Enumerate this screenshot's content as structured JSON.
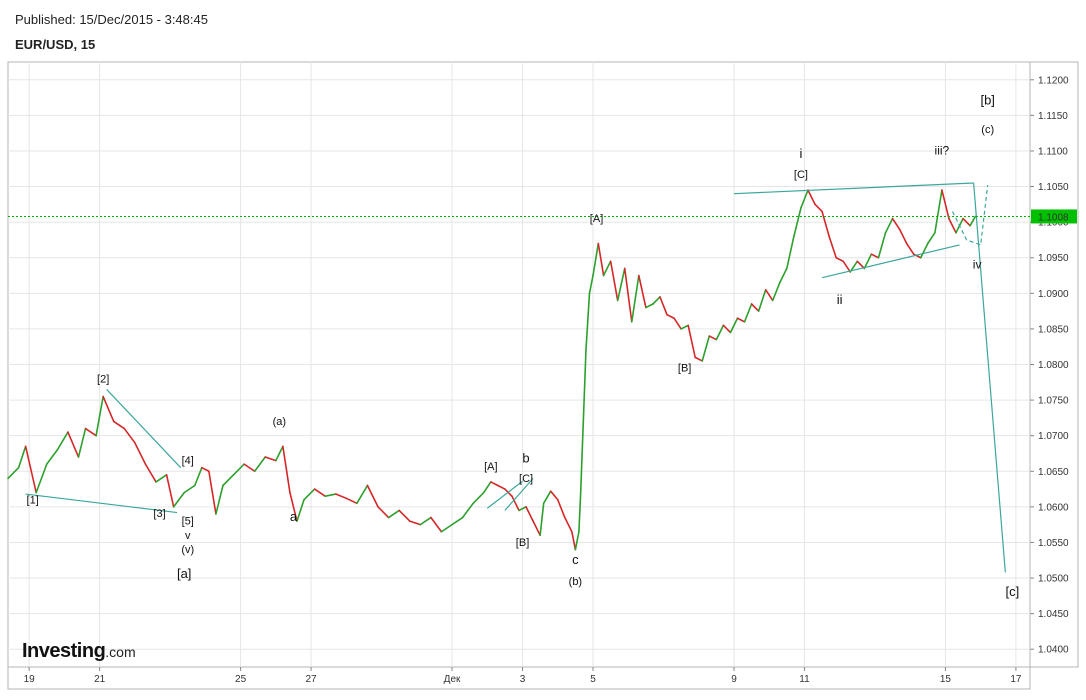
{
  "header": {
    "published": "Published: 15/Dec/2015 - 3:48:45",
    "symbol": "EUR/USD, 15"
  },
  "logo": {
    "brand": "Investing",
    "domain": ".com"
  },
  "colors": {
    "up": "#2ca02c",
    "down": "#d62728",
    "pattern": "#3aa79a",
    "current_price_line": "#00b000",
    "current_price_badge": "#00c000",
    "grid": "#e6e6e6"
  },
  "chart_data": {
    "type": "line",
    "ylim": [
      1.0375,
      1.1225
    ],
    "yticks": [
      1.04,
      1.045,
      1.05,
      1.055,
      1.06,
      1.065,
      1.07,
      1.075,
      1.08,
      1.085,
      1.09,
      1.095,
      1.1,
      1.105,
      1.11,
      1.115,
      1.12
    ],
    "ytick_labels": [
      "1.0400",
      "1.0450",
      "1.0500",
      "1.0550",
      "1.0600",
      "1.0650",
      "1.0700",
      "1.0750",
      "1.0800",
      "1.0850",
      "1.0900",
      "1.0950",
      "1.1000",
      "1.1050",
      "1.1100",
      "1.1150",
      "1.1200"
    ],
    "xlim": [
      18.4,
      17.4
    ],
    "x_axis_note": "day index: 18..30 = Nov 18..30, 31..47 = Dec 1..17",
    "xlim_index": [
      18.4,
      47.4
    ],
    "xticks": [
      {
        "t": 19,
        "label": "19"
      },
      {
        "t": 21,
        "label": "21"
      },
      {
        "t": 25,
        "label": "25"
      },
      {
        "t": 27,
        "label": "27"
      },
      {
        "t": 31,
        "label": "Дек"
      },
      {
        "t": 33,
        "label": "3"
      },
      {
        "t": 35,
        "label": "5"
      },
      {
        "t": 39,
        "label": "9"
      },
      {
        "t": 41,
        "label": "11"
      },
      {
        "t": 45,
        "label": "15"
      },
      {
        "t": 47,
        "label": "17"
      }
    ],
    "current_price": {
      "value": 1.1008,
      "label": "1.1008"
    },
    "price_path": [
      [
        18.4,
        1.064
      ],
      [
        18.7,
        1.0655
      ],
      [
        18.9,
        1.0685
      ],
      [
        19.2,
        1.062
      ],
      [
        19.5,
        1.066
      ],
      [
        19.8,
        1.068
      ],
      [
        20.1,
        1.0705
      ],
      [
        20.4,
        1.067
      ],
      [
        20.6,
        1.071
      ],
      [
        20.9,
        1.07
      ],
      [
        21.1,
        1.0755
      ],
      [
        21.4,
        1.072
      ],
      [
        21.7,
        1.071
      ],
      [
        22.0,
        1.069
      ],
      [
        22.3,
        1.066
      ],
      [
        22.6,
        1.0635
      ],
      [
        22.9,
        1.0645
      ],
      [
        23.1,
        1.06
      ],
      [
        23.4,
        1.062
      ],
      [
        23.7,
        1.063
      ],
      [
        23.9,
        1.0655
      ],
      [
        24.1,
        1.065
      ],
      [
        24.3,
        1.059
      ],
      [
        24.5,
        1.063
      ],
      [
        24.8,
        1.0645
      ],
      [
        25.1,
        1.066
      ],
      [
        25.4,
        1.065
      ],
      [
        25.7,
        1.067
      ],
      [
        26.0,
        1.0665
      ],
      [
        26.2,
        1.0685
      ],
      [
        26.4,
        1.062
      ],
      [
        26.6,
        1.058
      ],
      [
        26.8,
        1.061
      ],
      [
        27.1,
        1.0625
      ],
      [
        27.4,
        1.0615
      ],
      [
        27.7,
        1.0618
      ],
      [
        28.0,
        1.0612
      ],
      [
        28.3,
        1.0605
      ],
      [
        28.6,
        1.063
      ],
      [
        28.9,
        1.06
      ],
      [
        29.2,
        1.0585
      ],
      [
        29.5,
        1.0595
      ],
      [
        29.8,
        1.058
      ],
      [
        30.1,
        1.0575
      ],
      [
        30.4,
        1.0585
      ],
      [
        30.7,
        1.0565
      ],
      [
        31.0,
        1.0575
      ],
      [
        31.3,
        1.0585
      ],
      [
        31.6,
        1.0605
      ],
      [
        31.9,
        1.062
      ],
      [
        32.1,
        1.0635
      ],
      [
        32.3,
        1.063
      ],
      [
        32.5,
        1.0625
      ],
      [
        32.7,
        1.0615
      ],
      [
        32.9,
        1.0595
      ],
      [
        33.1,
        1.06
      ],
      [
        33.3,
        1.058
      ],
      [
        33.5,
        1.056
      ],
      [
        33.6,
        1.0605
      ],
      [
        33.8,
        1.0622
      ],
      [
        34.0,
        1.061
      ],
      [
        34.2,
        1.0585
      ],
      [
        34.4,
        1.0565
      ],
      [
        34.5,
        1.054
      ],
      [
        34.6,
        1.0565
      ],
      [
        34.65,
        1.062
      ],
      [
        34.8,
        1.082
      ],
      [
        34.9,
        1.09
      ],
      [
        35.0,
        1.0925
      ],
      [
        35.15,
        1.097
      ],
      [
        35.3,
        1.0925
      ],
      [
        35.5,
        1.0945
      ],
      [
        35.7,
        1.089
      ],
      [
        35.9,
        1.0935
      ],
      [
        36.1,
        1.086
      ],
      [
        36.3,
        1.0925
      ],
      [
        36.5,
        1.088
      ],
      [
        36.7,
        1.0885
      ],
      [
        36.9,
        1.0895
      ],
      [
        37.1,
        1.087
      ],
      [
        37.3,
        1.0865
      ],
      [
        37.5,
        1.085
      ],
      [
        37.7,
        1.0855
      ],
      [
        37.9,
        1.081
      ],
      [
        38.1,
        1.0805
      ],
      [
        38.3,
        1.084
      ],
      [
        38.5,
        1.0835
      ],
      [
        38.7,
        1.0855
      ],
      [
        38.9,
        1.0845
      ],
      [
        39.1,
        1.0865
      ],
      [
        39.3,
        1.086
      ],
      [
        39.5,
        1.0885
      ],
      [
        39.7,
        1.0875
      ],
      [
        39.9,
        1.0905
      ],
      [
        40.1,
        1.089
      ],
      [
        40.3,
        1.0915
      ],
      [
        40.5,
        1.0935
      ],
      [
        40.7,
        1.098
      ],
      [
        40.9,
        1.102
      ],
      [
        41.1,
        1.1045
      ],
      [
        41.3,
        1.1025
      ],
      [
        41.5,
        1.1015
      ],
      [
        41.7,
        1.098
      ],
      [
        41.9,
        1.095
      ],
      [
        42.1,
        1.0945
      ],
      [
        42.3,
        1.093
      ],
      [
        42.5,
        1.0945
      ],
      [
        42.7,
        1.0935
      ],
      [
        42.9,
        1.0955
      ],
      [
        43.1,
        1.095
      ],
      [
        43.3,
        1.0985
      ],
      [
        43.5,
        1.1005
      ],
      [
        43.7,
        1.099
      ],
      [
        43.9,
        1.097
      ],
      [
        44.1,
        1.0955
      ],
      [
        44.3,
        1.095
      ],
      [
        44.5,
        1.097
      ],
      [
        44.7,
        1.0985
      ],
      [
        44.9,
        1.1045
      ],
      [
        45.1,
        1.1005
      ],
      [
        45.3,
        1.0985
      ],
      [
        45.5,
        1.1005
      ],
      [
        45.7,
        1.0995
      ],
      [
        45.85,
        1.1008
      ]
    ],
    "pattern_lines": [
      [
        [
          18.9,
          1.0618
        ],
        [
          23.2,
          1.0592
        ]
      ],
      [
        [
          21.2,
          1.0765
        ],
        [
          23.3,
          1.0655
        ]
      ],
      [
        [
          32.0,
          1.0598
        ],
        [
          33.0,
          1.0636
        ]
      ],
      [
        [
          32.5,
          1.0595
        ],
        [
          33.3,
          1.064
        ]
      ],
      [
        [
          39.0,
          1.104
        ],
        [
          45.8,
          1.1055
        ]
      ],
      [
        [
          41.5,
          1.0922
        ],
        [
          45.4,
          1.0968
        ]
      ],
      [
        [
          45.8,
          1.1055
        ],
        [
          46.7,
          1.0508
        ]
      ]
    ],
    "pattern_dashed": [
      [
        [
          45.2,
          1.1015
        ],
        [
          45.6,
          1.0975
        ],
        [
          46.0,
          1.0968
        ],
        [
          46.2,
          1.1052
        ]
      ]
    ],
    "annotations": [
      {
        "text": "[1]",
        "x": 19.1,
        "y": 1.0605,
        "size": 11
      },
      {
        "text": "[2]",
        "x": 21.1,
        "y": 1.0775,
        "size": 11
      },
      {
        "text": "[3]",
        "x": 22.7,
        "y": 1.0586,
        "size": 11
      },
      {
        "text": "[4]",
        "x": 23.5,
        "y": 1.066,
        "size": 11
      },
      {
        "text": "[5]",
        "x": 23.5,
        "y": 1.0575,
        "size": 11
      },
      {
        "text": "v",
        "x": 23.5,
        "y": 1.0555,
        "size": 11
      },
      {
        "text": "(v)",
        "x": 23.5,
        "y": 1.0535,
        "size": 11
      },
      {
        "text": "[a]",
        "x": 23.4,
        "y": 1.05,
        "size": 13
      },
      {
        "text": "(a)",
        "x": 26.1,
        "y": 1.0715,
        "size": 11
      },
      {
        "text": "a",
        "x": 26.5,
        "y": 1.058,
        "size": 13
      },
      {
        "text": "[A]",
        "x": 32.1,
        "y": 1.0652,
        "size": 11
      },
      {
        "text": "b",
        "x": 33.1,
        "y": 1.0662,
        "size": 13
      },
      {
        "text": "[C]",
        "x": 33.1,
        "y": 1.0635,
        "size": 11
      },
      {
        "text": "[B]",
        "x": 33.0,
        "y": 1.0545,
        "size": 11
      },
      {
        "text": "c",
        "x": 34.5,
        "y": 1.052,
        "size": 13
      },
      {
        "text": "(b)",
        "x": 34.5,
        "y": 1.049,
        "size": 11
      },
      {
        "text": "[A]",
        "x": 35.1,
        "y": 1.1,
        "size": 11
      },
      {
        "text": "[B]",
        "x": 37.6,
        "y": 1.079,
        "size": 11
      },
      {
        "text": "i",
        "x": 40.9,
        "y": 1.109,
        "size": 13
      },
      {
        "text": "[C]",
        "x": 40.9,
        "y": 1.1062,
        "size": 11
      },
      {
        "text": "ii",
        "x": 42.0,
        "y": 1.0885,
        "size": 13
      },
      {
        "text": "iii?",
        "x": 44.9,
        "y": 1.1095,
        "size": 12
      },
      {
        "text": "iv",
        "x": 45.9,
        "y": 1.0935,
        "size": 12
      },
      {
        "text": "[b]",
        "x": 46.2,
        "y": 1.1165,
        "size": 13
      },
      {
        "text": "(c)",
        "x": 46.2,
        "y": 1.1125,
        "size": 11
      },
      {
        "text": "[c]",
        "x": 46.9,
        "y": 1.0475,
        "size": 13
      }
    ]
  }
}
